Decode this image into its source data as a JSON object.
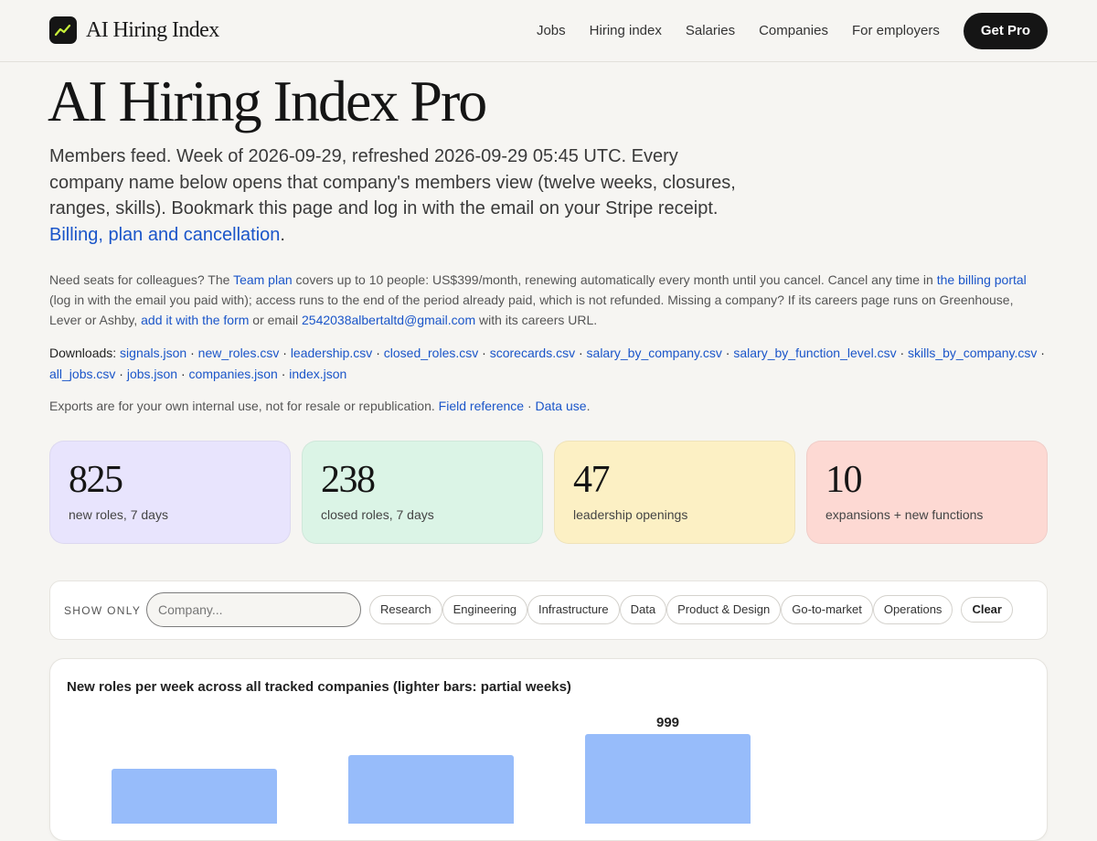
{
  "header": {
    "brand": "AI Hiring Index",
    "nav": [
      "Jobs",
      "Hiring index",
      "Salaries",
      "Companies",
      "For employers"
    ],
    "cta": "Get Pro"
  },
  "hero": {
    "title": "AI Hiring Index Pro",
    "lede_text": "Members feed. Week of 2026-09-29, refreshed 2026-09-29 05:45 UTC. Every company name below opens that company's members view (twelve weeks, closures, ranges, skills). Bookmark this page and log in with the email on your Stripe receipt. ",
    "lede_link": "Billing, plan and cancellation",
    "lede_end": "."
  },
  "seats": {
    "t1": "Need seats for colleagues? The ",
    "team_plan": "Team plan",
    "t2": " covers up to 10 people: US$399/month, renewing automatically every month until you cancel. Cancel any time in ",
    "billing_portal": "the billing portal",
    "t3": " (log in with the email you paid with); access runs to the end of the period already paid, which is not refunded. Missing a company? If its careers page runs on Greenhouse, Lever or Ashby, ",
    "add_form": "add it with the form",
    "t4": " or email ",
    "email": "2542038albertaltd@gmail.com",
    "t5": " with its careers URL."
  },
  "downloads": {
    "label": "Downloads:",
    "files": [
      "signals.json",
      "new_roles.csv",
      "leadership.csv",
      "closed_roles.csv",
      "scorecards.csv",
      "salary_by_company.csv",
      "salary_by_function_level.csv",
      "skills_by_company.csv",
      "all_jobs.csv",
      "jobs.json",
      "companies.json",
      "index.json"
    ]
  },
  "exports": {
    "text": "Exports are for your own internal use, not for resale or republication. ",
    "field_ref": "Field reference",
    "sep": " · ",
    "data_use": "Data use",
    "end": "."
  },
  "stats": [
    {
      "value": "825",
      "label": "new roles, 7 days",
      "color": "#e8e4fd"
    },
    {
      "value": "238",
      "label": "closed roles, 7 days",
      "color": "#dbf4e6"
    },
    {
      "value": "47",
      "label": "leadership openings",
      "color": "#fcf0c4"
    },
    {
      "value": "10",
      "label": "expansions + new functions",
      "color": "#fdd9d3"
    }
  ],
  "filter": {
    "label": "SHOW ONLY",
    "placeholder": "Company...",
    "pills": [
      "Research",
      "Engineering",
      "Infrastructure",
      "Data",
      "Product & Design",
      "Go-to-market",
      "Operations"
    ],
    "clear": "Clear"
  },
  "chart_data": {
    "type": "bar",
    "title": "New roles per week across all tracked companies (lighter bars: partial weeks)",
    "values": [
      null,
      null,
      999
    ],
    "data_labels": [
      "",
      "",
      "999"
    ],
    "bar_color": "#97bcfa"
  }
}
